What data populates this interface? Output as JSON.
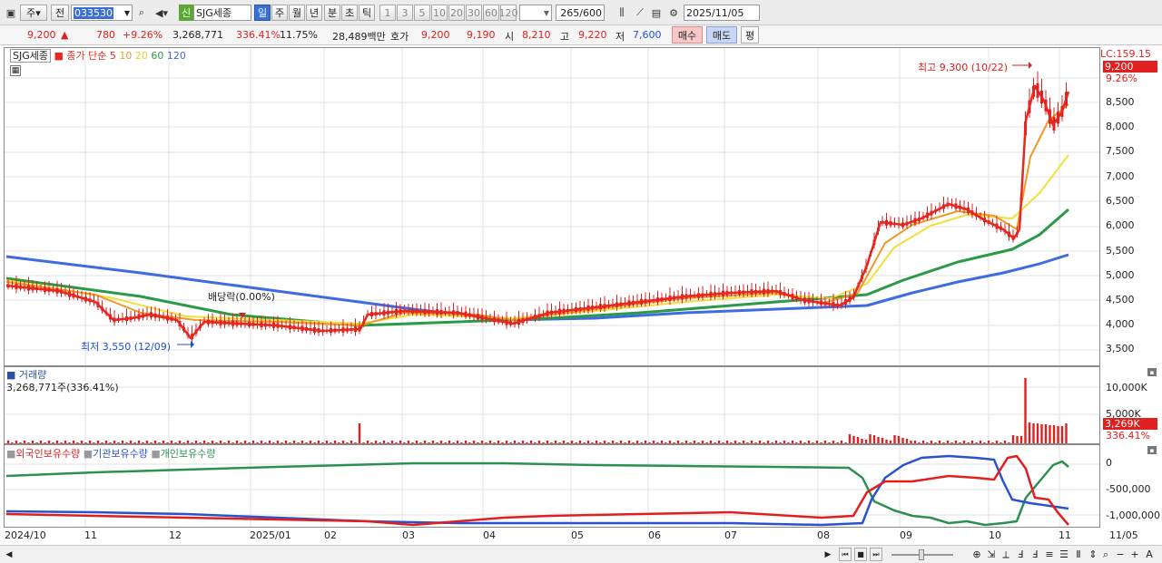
{
  "toolbar": {
    "market_label": "주",
    "prev_label": "전",
    "code": "033530",
    "new_badge": "신",
    "stock_name": "SJG세종",
    "period_buttons": [
      "일",
      "주",
      "월",
      "년",
      "분",
      "초",
      "틱"
    ],
    "tick_values": [
      "1",
      "3",
      "5",
      "10",
      "20",
      "30",
      "60",
      "120"
    ],
    "bars": "265",
    "bars_total": "/600",
    "date": "2025/11/05"
  },
  "quote": {
    "price": "9,200",
    "arrow": "▲",
    "change": "780",
    "change_pct": "+9.26%",
    "volume": "3,268,771",
    "vol_ratio": "336.41%",
    "turnover": "11.75%",
    "amount": "28,489백만",
    "ask_label": "호가",
    "ask": "9,200",
    "bid": "9,190",
    "open_label": "시",
    "open": "8,210",
    "high_label": "고",
    "high": "9,220",
    "low_label": "저",
    "low": "7,600",
    "buy_label": "매수",
    "sell_label": "매도",
    "avg_label": "평"
  },
  "price_panel": {
    "legend_name": "SJG세종",
    "legend_ma": "종가 단순",
    "ma_periods": [
      {
        "label": "5",
        "color": "#e8281e"
      },
      {
        "label": "10",
        "color": "#ee9a2a"
      },
      {
        "label": "20",
        "color": "#f0e03c"
      },
      {
        "label": "60",
        "color": "#2b9a48"
      },
      {
        "label": "120",
        "color": "#3f6be0"
      }
    ],
    "max_annotation": "최고 9,300 (10/22)",
    "min_annotation": "최저 3,550 (12/09)",
    "dividend_annotation": "배당락(0.00%)",
    "axis_top_label": "LC:159.15",
    "current_price_badge": "9,200",
    "current_pct_badge": "9.26%",
    "y_ticks": [
      "8,500",
      "8,000",
      "7,500",
      "7,000",
      "6,500",
      "6,000",
      "5,500",
      "5,000",
      "4,500",
      "4,000",
      "3,500"
    ]
  },
  "volume_panel": {
    "title": "거래량",
    "subtitle": "3,268,771주(336.41%)",
    "y_ticks": [
      "10,000K",
      "5,000K"
    ],
    "current_badge": "3,269K",
    "current_pct": "336.41%"
  },
  "holder_panel": {
    "series": [
      {
        "label": "외국인보유수량",
        "color": "#e02020"
      },
      {
        "label": "기관보유수량",
        "color": "#2a52d0"
      },
      {
        "label": "개인보유수량",
        "color": "#2c9050"
      }
    ],
    "y_ticks": [
      "0",
      "-500,000",
      "-1,000,000"
    ]
  },
  "x_axis": {
    "labels": [
      "2024/10",
      "11",
      "12",
      "2025/01",
      "02",
      "03",
      "04",
      "05",
      "06",
      "07",
      "08",
      "09",
      "10",
      "11"
    ],
    "last_label": "11/05"
  },
  "colors": {
    "up": "#e02020",
    "down": "#2050d0",
    "accent": "#2a5fbf"
  }
}
